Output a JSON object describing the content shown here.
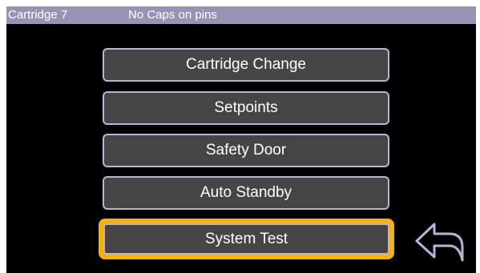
{
  "status_bar": {
    "cartridge": "Cartridge 7",
    "message": "No Caps on pins"
  },
  "menu": {
    "items": [
      {
        "label": "Cartridge Change"
      },
      {
        "label": "Setpoints"
      },
      {
        "label": "Safety Door"
      },
      {
        "label": "Auto Standby"
      },
      {
        "label": "System Test",
        "selected": true
      }
    ]
  },
  "icons": {
    "back": "back-arrow-icon"
  },
  "colors": {
    "status_bar": "#9892b4",
    "button_fill": "#454545",
    "button_border": "#b9b4d6",
    "selection_highlight": "#f5b400",
    "background": "#000000"
  }
}
